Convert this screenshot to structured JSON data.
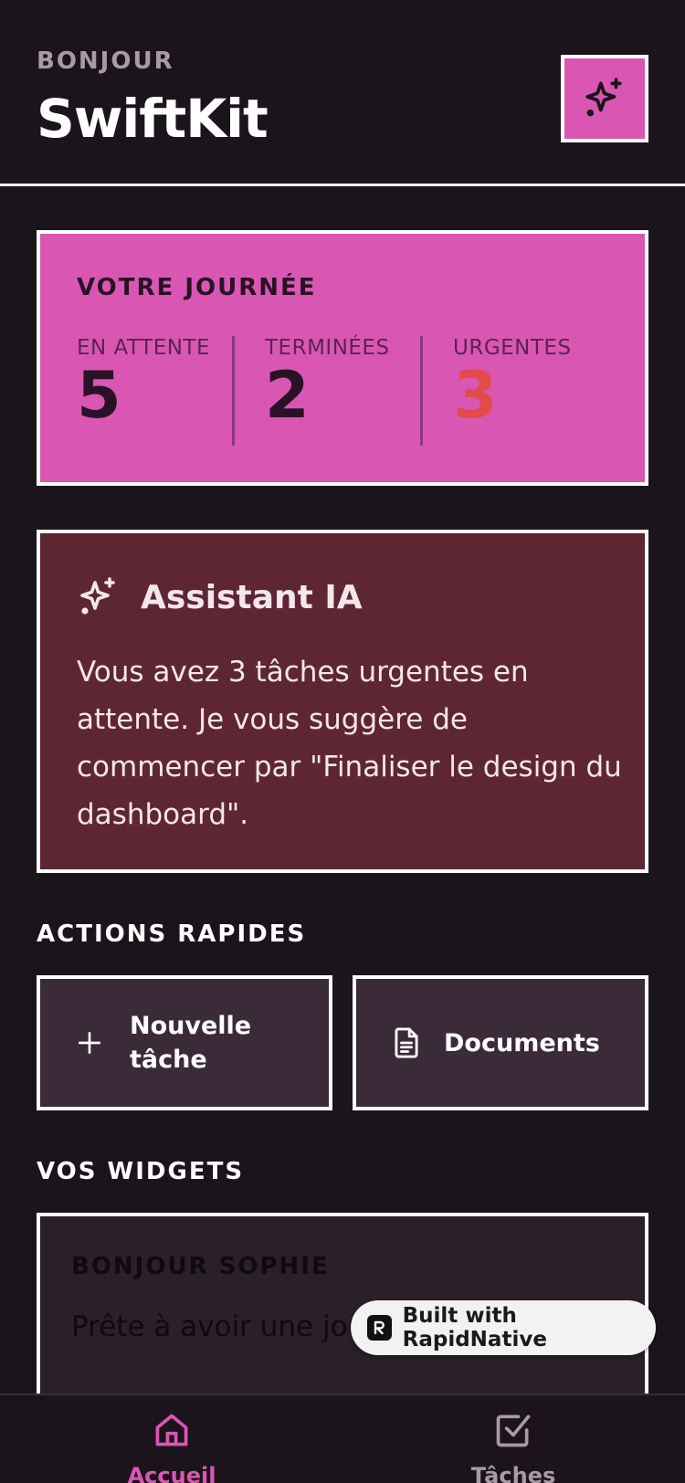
{
  "header": {
    "greeting": "BONJOUR",
    "app_title": "SwiftKit",
    "ai_button_icon": "sparkles-icon"
  },
  "day_summary": {
    "title": "VOTRE JOURNÉE",
    "stats": [
      {
        "label": "EN ATTENTE",
        "value": "5"
      },
      {
        "label": "TERMINÉES",
        "value": "2"
      },
      {
        "label": "URGENTES",
        "value": "3"
      }
    ]
  },
  "ai_assistant": {
    "icon": "sparkles-icon",
    "title": "Assistant IA",
    "message": "Vous avez 3 tâches urgentes en attente. Je vous suggère de commencer par \"Finaliser le design du dashboard\"."
  },
  "quick_actions": {
    "title": "ACTIONS RAPIDES",
    "items": [
      {
        "icon": "plus-icon",
        "label_line1": "Nouvelle",
        "label_line2": "tâche"
      },
      {
        "icon": "document-icon",
        "label": "Documents"
      }
    ]
  },
  "widgets": {
    "title": "VOS WIDGETS",
    "greeting_widget": {
      "title": "BONJOUR SOPHIE",
      "text": "Prête à avoir une journée sereine ?"
    }
  },
  "badge": {
    "logo_icon": "rapidnative-logo-icon",
    "text": "Built with RapidNative"
  },
  "bottom_nav": {
    "items": [
      {
        "icon": "home-icon",
        "label": "Accueil",
        "active": true
      },
      {
        "icon": "checkbox-icon",
        "label": "Tâches",
        "active": false
      }
    ]
  },
  "colors": {
    "background": "#1c141c",
    "accent_pink": "#d957b3",
    "ai_card": "#5e2633",
    "action_card": "#3b2b38",
    "urgent": "#e34b4b",
    "nav_inactive": "#a99aa6"
  }
}
